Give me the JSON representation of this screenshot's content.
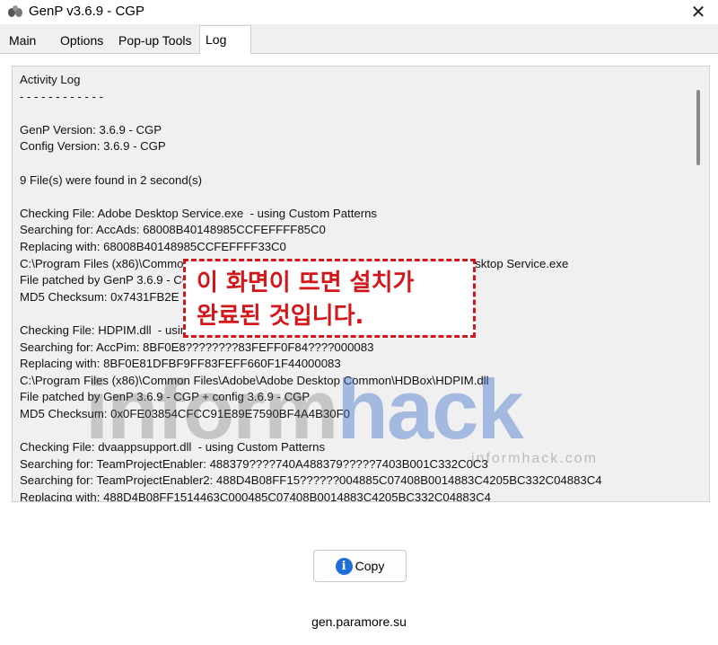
{
  "window": {
    "title": "GenP v3.6.9 - CGP",
    "close_label": "✕"
  },
  "tabs": [
    {
      "label": "Main",
      "active": false
    },
    {
      "label": "Options",
      "active": false
    },
    {
      "label": "Pop-up Tools",
      "active": false
    },
    {
      "label": "Log",
      "active": true
    }
  ],
  "log": {
    "lines": [
      "Activity Log",
      "- - - - - - - - - - - -",
      "",
      "GenP Version: 3.6.9 - CGP",
      "Config Version: 3.6.9 - CGP",
      "",
      "9 File(s) were found in 2 second(s)",
      "",
      "Checking File: Adobe Desktop Service.exe  - using Custom Patterns",
      "Searching for: AccAds: 68008B40148985CCFEFFFF85C0",
      "Replacing with: 68008B40148985CCFEFFFF33C0",
      "C:\\Program Files (x86)\\Common Files\\Adobe\\Adobe Desktop Common\\ADS\\Adobe Desktop Service.exe",
      "File patched by GenP 3.6.9 - CGP + config 3.6.9 - CGP",
      "MD5 Checksum: 0x7431FB2E",
      "",
      "Checking File: HDPIM.dll  - using Custom Patterns",
      "Searching for: AccPim: 8BF0E8????????83FEFF0F84????000083",
      "Replacing with: 8BF0E81DFBF9FF83FEFF660F1F44000083",
      "C:\\Program Files (x86)\\Common Files\\Adobe\\Adobe Desktop Common\\HDBox\\HDPIM.dll",
      "File patched by GenP 3.6.9 - CGP + config 3.6.9 - CGP",
      "MD5 Checksum: 0x0FE03854CFCC91E89E7590BF4A4B30F0",
      "",
      "Checking File: dvaappsupport.dll  - using Custom Patterns",
      "Searching for: TeamProjectEnabler: 488379????740A488379?????7403B001C332C0C3",
      "Searching for: TeamProjectEnabler2: 488D4B08FF15??????004885C07408B0014883C4205BC332C04883C4",
      "Replacing with: 488D4B08FF1514463C000485C07408B0014883C4205BC332C04883C4"
    ]
  },
  "callout": {
    "line1": "이 화면이 뜨면 설치가",
    "line2": "완료된 것입니다."
  },
  "watermark": {
    "part1": "inform",
    "part2": "hack",
    "sub": "informhack.com"
  },
  "copy_button": {
    "label": "Copy"
  },
  "footer": {
    "text": "gen.paramore.su"
  },
  "colors": {
    "callout_red": "#d4161b",
    "info_blue": "#1f6fd6"
  }
}
